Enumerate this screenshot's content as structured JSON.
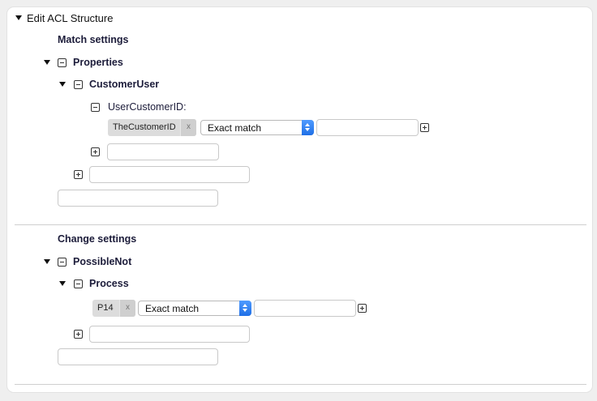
{
  "panel": {
    "title": "Edit ACL Structure"
  },
  "match": {
    "heading": "Match settings",
    "properties": {
      "label": "Properties",
      "customer_user": {
        "label": "CustomerUser",
        "field": {
          "label": "UserCustomerID:",
          "tag": "TheCustomerID",
          "tag_remove": "x",
          "match_type": "Exact match",
          "value": ""
        }
      }
    }
  },
  "change": {
    "heading": "Change settings",
    "possible_not": {
      "label": "PossibleNot",
      "process": {
        "label": "Process",
        "tag": "P14",
        "tag_remove": "x",
        "match_type": "Exact match",
        "value": ""
      }
    }
  },
  "icons": {
    "expand": "triangle-down-icon",
    "collapse": "minus-box-icon",
    "add": "plus-box-icon"
  }
}
